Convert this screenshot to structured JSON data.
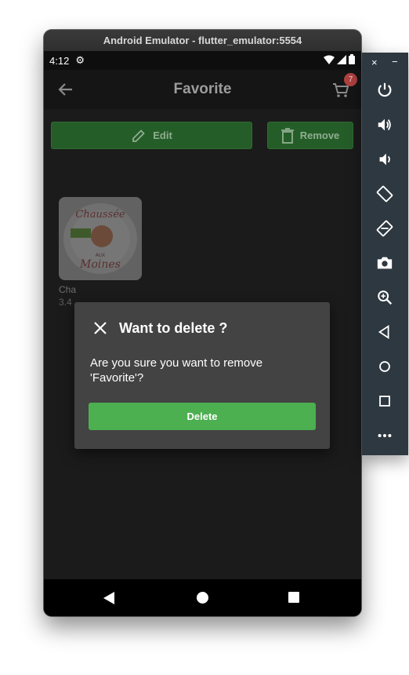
{
  "window": {
    "title": "Android Emulator - flutter_emulator:5554"
  },
  "status_bar": {
    "time": "4:12",
    "icons": [
      "gear-icon",
      "wifi-icon",
      "signal-icon",
      "battery-icon"
    ]
  },
  "app_bar": {
    "title": "Favorite",
    "cart_count": "7"
  },
  "toolbar": {
    "edit_label": "Edit",
    "remove_label": "Remove"
  },
  "product": {
    "name": "Cha",
    "price": "3.4",
    "image_text": [
      "Chaussée",
      "Moines",
      "AUX"
    ]
  },
  "dialog": {
    "title": "Want to delete ?",
    "message": "Are you sure you want to remove 'Favorite'?",
    "delete_label": "Delete"
  },
  "side_toolbar": {
    "close_symbol": "×",
    "minimize_symbol": "−",
    "buttons": [
      "power-icon",
      "volume-up-icon",
      "volume-down-icon",
      "rotate-left-icon",
      "rotate-right-icon",
      "camera-icon",
      "zoom-icon",
      "back-icon",
      "home-icon",
      "overview-icon",
      "more-icon"
    ]
  },
  "colors": {
    "accent_green": "#4caf50",
    "dim_green": "#255d29",
    "badge_red": "#b04040",
    "dialog_bg": "#434343"
  }
}
